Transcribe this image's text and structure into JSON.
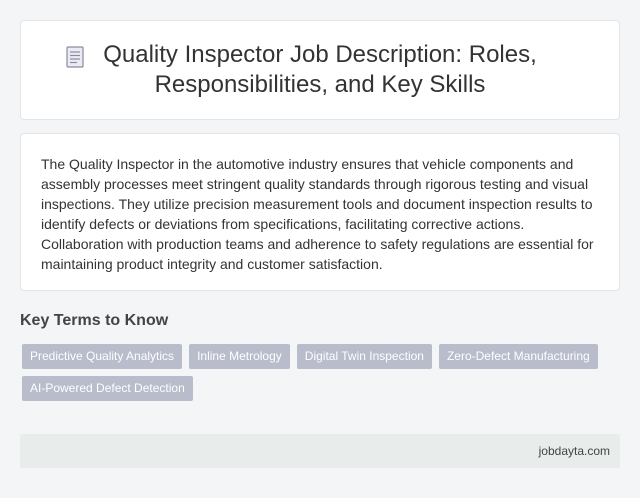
{
  "header": {
    "title": "Quality Inspector Job Description: Roles, Responsibilities, and Key Skills",
    "icon": "document-icon"
  },
  "description": "The Quality Inspector in the automotive industry ensures that vehicle components and assembly processes meet stringent quality standards through rigorous testing and visual inspections. They utilize precision measurement tools and document inspection results to identify defects or deviations from specifications, facilitating corrective actions. Collaboration with production teams and adherence to safety regulations are essential for maintaining product integrity and customer satisfaction.",
  "key_terms": {
    "heading": "Key Terms to Know",
    "tags": [
      "Predictive Quality Analytics",
      "Inline Metrology",
      "Digital Twin Inspection",
      "Zero-Defect Manufacturing",
      "AI-Powered Defect Detection"
    ]
  },
  "footer": {
    "site": "jobdayta.com"
  },
  "colors": {
    "tag_bg": "#b8bccb",
    "footer_bg": "#e8eceb",
    "page_bg": "#f4f5f7"
  }
}
